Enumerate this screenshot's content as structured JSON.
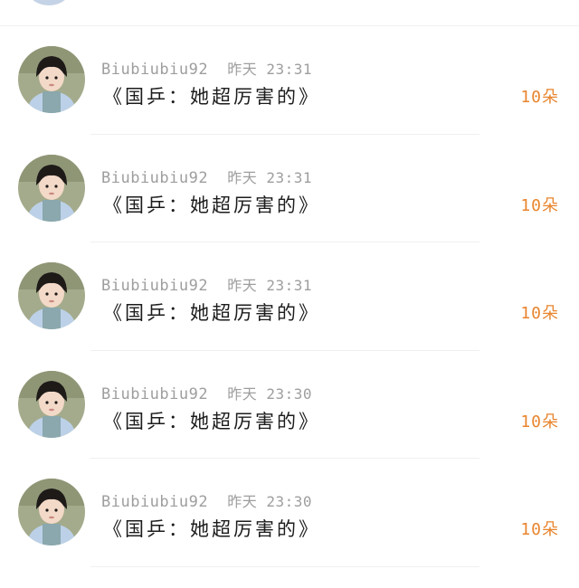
{
  "colors": {
    "accent": "#e8852e",
    "meta_text": "#9e9e9e",
    "message_text": "#1c1c1c"
  },
  "messages": [
    {
      "username": "Biubiubiu92",
      "time": "昨天 23:31",
      "text": "《国乒：她超厉害的》",
      "count": "10朵"
    },
    {
      "username": "Biubiubiu92",
      "time": "昨天 23:31",
      "text": "《国乒：她超厉害的》",
      "count": "10朵"
    },
    {
      "username": "Biubiubiu92",
      "time": "昨天 23:31",
      "text": "《国乒：她超厉害的》",
      "count": "10朵"
    },
    {
      "username": "Biubiubiu92",
      "time": "昨天 23:30",
      "text": "《国乒：她超厉害的》",
      "count": "10朵"
    },
    {
      "username": "Biubiubiu92",
      "time": "昨天 23:30",
      "text": "《国乒：她超厉害的》",
      "count": "10朵"
    }
  ]
}
